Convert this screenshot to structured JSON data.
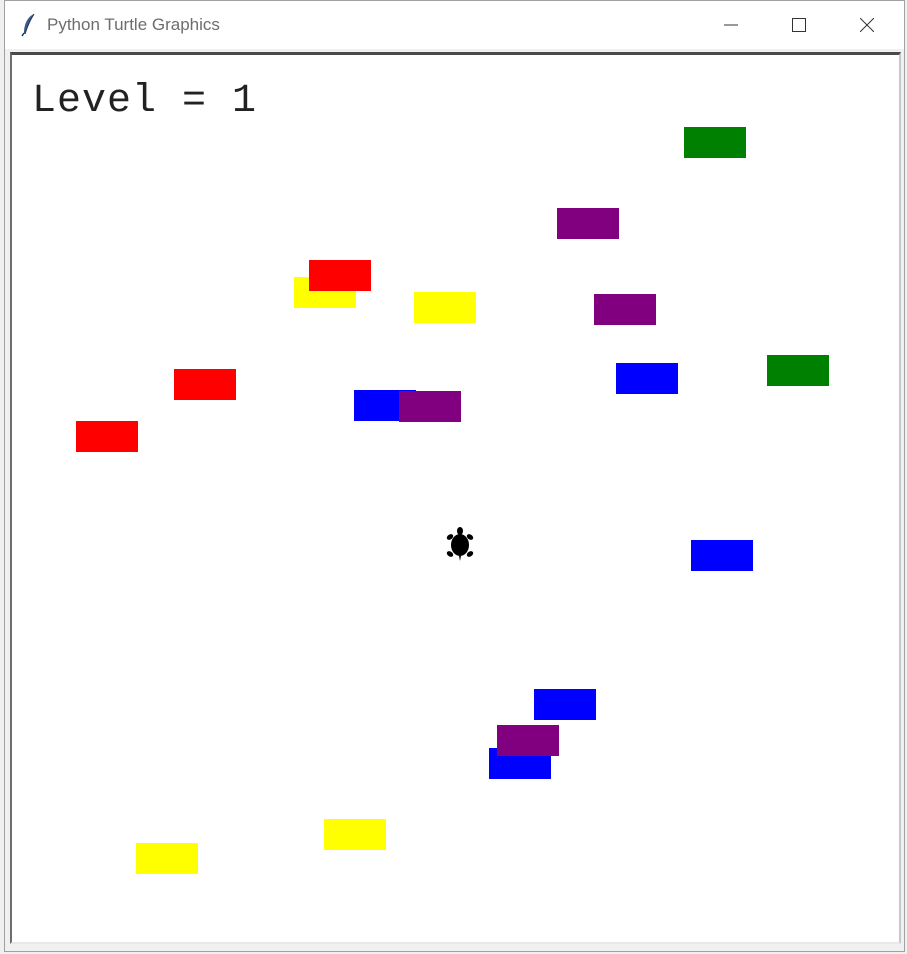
{
  "window": {
    "title": "Python Turtle Graphics",
    "icon": "feather-icon",
    "controls": [
      "minimize-icon",
      "maximize-icon",
      "close-icon"
    ]
  },
  "game": {
    "level_text": "Level = 1",
    "player": {
      "shape": "turtle",
      "color": "#000000"
    },
    "blocks": [
      {
        "color": "green"
      },
      {
        "color": "purple"
      },
      {
        "color": "yellow"
      },
      {
        "color": "red"
      },
      {
        "color": "yellow"
      },
      {
        "color": "purple"
      },
      {
        "color": "blue"
      },
      {
        "color": "green"
      },
      {
        "color": "red"
      },
      {
        "color": "blue"
      },
      {
        "color": "purple"
      },
      {
        "color": "red"
      },
      {
        "color": "blue"
      },
      {
        "color": "blue"
      },
      {
        "color": "blue"
      },
      {
        "color": "purple"
      },
      {
        "color": "yellow"
      },
      {
        "color": "yellow"
      }
    ]
  },
  "palette": {
    "green": "#008000",
    "purple": "#800080",
    "yellow": "#ffff00",
    "red": "#ff0000",
    "blue": "#0000ff"
  }
}
